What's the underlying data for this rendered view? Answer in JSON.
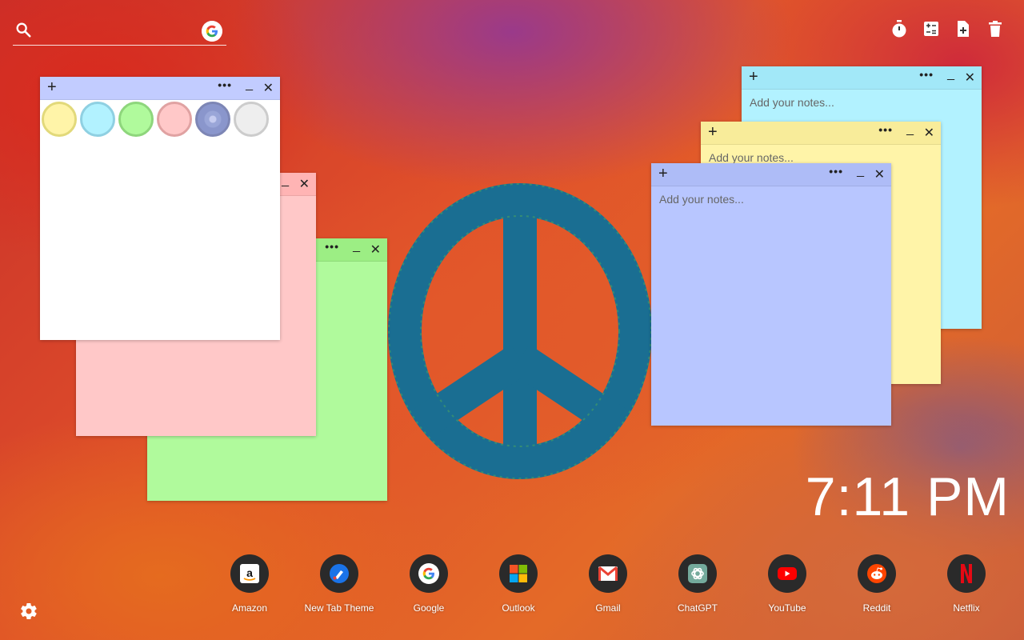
{
  "search": {
    "placeholder": "",
    "search_icon": "search-icon",
    "engine_icon": "google-icon"
  },
  "toolbar": {
    "icons": [
      "timer-icon",
      "calculator-icon",
      "add-note-icon",
      "trash-icon"
    ]
  },
  "notes": {
    "placeholder": "Add your notes...",
    "plus_label": "+",
    "more_label": "•••",
    "minimize_label": "_",
    "close_label": "✕",
    "colors": {
      "white": "#ffffff",
      "pink": "#ffc8c8",
      "green": "#b0fa9c",
      "cyan": "#b2f2ff",
      "yellow": "#fff4a8",
      "blue": "#b8c6ff",
      "header_white": "#c2ccff",
      "header_pink": "#ffb4b4",
      "header_green": "#9cee84",
      "header_cyan": "#a2e8f8",
      "header_yellow": "#f8ec9a",
      "header_blue": "#aebcf7"
    },
    "swatches": [
      {
        "name": "yellow",
        "fill": "#fff4a8",
        "ring": "#e2d97a"
      },
      {
        "name": "cyan",
        "fill": "#b2f2ff",
        "ring": "#8fd0e2"
      },
      {
        "name": "green",
        "fill": "#b0fa9c",
        "ring": "#8ed67c"
      },
      {
        "name": "pink",
        "fill": "#ffc8c8",
        "ring": "#e0a2a2"
      },
      {
        "name": "purple",
        "fill": "#9aa6d8",
        "ring": "#7d86b5"
      },
      {
        "name": "gray",
        "fill": "#eeeeee",
        "ring": "#cccccc"
      }
    ]
  },
  "clock": {
    "time": "7:11 PM"
  },
  "shortcuts": [
    {
      "label": "Amazon",
      "icon": "amazon-icon"
    },
    {
      "label": "New Tab Theme",
      "icon": "new-tab-theme-icon"
    },
    {
      "label": "Google",
      "icon": "google-icon"
    },
    {
      "label": "Outlook",
      "icon": "outlook-icon"
    },
    {
      "label": "Gmail",
      "icon": "gmail-icon"
    },
    {
      "label": "ChatGPT",
      "icon": "chatgpt-icon"
    },
    {
      "label": "YouTube",
      "icon": "youtube-icon"
    },
    {
      "label": "Reddit",
      "icon": "reddit-icon"
    },
    {
      "label": "Netflix",
      "icon": "netflix-icon"
    }
  ],
  "settings": {
    "icon": "gear-icon"
  }
}
